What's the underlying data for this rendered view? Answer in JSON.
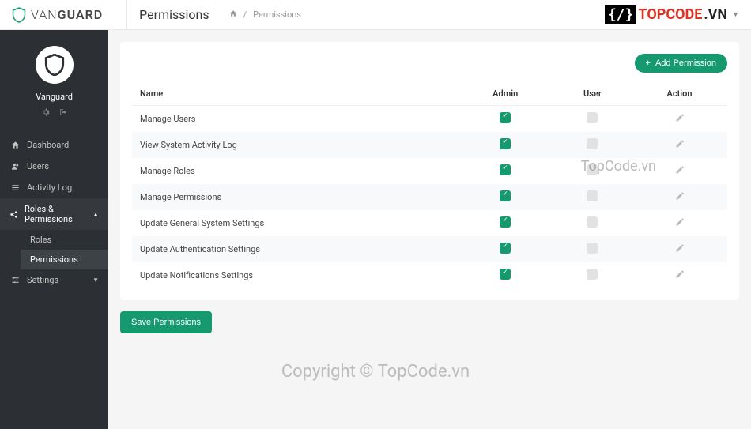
{
  "brand": {
    "name_light": "VAN",
    "name_bold": "GUARD"
  },
  "header": {
    "title": "Permissions",
    "breadcrumb_current": "Permissions"
  },
  "sidebar": {
    "profile_name": "Vanguard",
    "items": [
      {
        "label": "Dashboard"
      },
      {
        "label": "Users"
      },
      {
        "label": "Activity Log"
      },
      {
        "label": "Roles & Permissions"
      },
      {
        "label": "Settings"
      }
    ],
    "sub_roles": {
      "roles_label": "Roles",
      "permissions_label": "Permissions"
    }
  },
  "table": {
    "add_button": "Add Permission",
    "headers": {
      "name": "Name",
      "admin": "Admin",
      "user": "User",
      "action": "Action"
    },
    "rows": [
      {
        "name": "Manage Users",
        "admin": true,
        "user": false
      },
      {
        "name": "View System Activity Log",
        "admin": true,
        "user": false
      },
      {
        "name": "Manage Roles",
        "admin": true,
        "user": false
      },
      {
        "name": "Manage Permissions",
        "admin": true,
        "user": false
      },
      {
        "name": "Update General System Settings",
        "admin": true,
        "user": false
      },
      {
        "name": "Update Authentication Settings",
        "admin": true,
        "user": false
      },
      {
        "name": "Update Notifications Settings",
        "admin": true,
        "user": false
      }
    ],
    "save_button": "Save Permissions"
  },
  "watermarks": {
    "center": "TopCode.vn",
    "bottom": "Copyright © TopCode.vn",
    "logo_top": "TOPCODE",
    "logo_ext": ".VN"
  }
}
